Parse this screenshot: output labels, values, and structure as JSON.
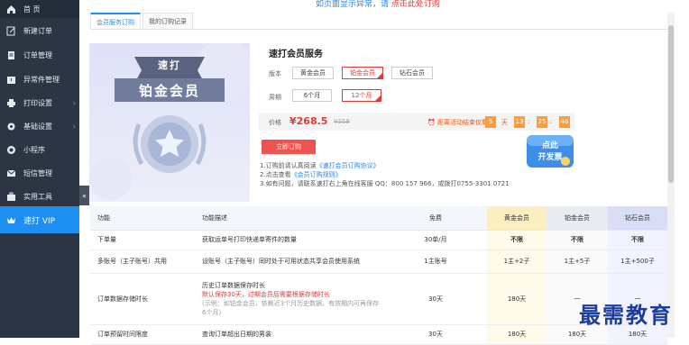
{
  "sidebar": {
    "items": [
      {
        "label": "首 页",
        "icon": "home-icon"
      },
      {
        "label": "新建订单",
        "icon": "edit-icon"
      },
      {
        "label": "订单管理",
        "icon": "document-icon"
      },
      {
        "label": "异常件管理",
        "icon": "warning-icon"
      },
      {
        "label": "打印设置",
        "icon": "printer-icon"
      },
      {
        "label": "基础设置",
        "icon": "gear-icon"
      },
      {
        "label": "小程序",
        "icon": "miniprogram-icon"
      },
      {
        "label": "短信管理",
        "icon": "sms-icon"
      },
      {
        "label": "实用工具",
        "icon": "toolbox-icon"
      },
      {
        "label": "速打 VIP",
        "icon": "vip-icon"
      }
    ],
    "collapse_glyph": "«"
  },
  "top_notice": {
    "text": "如页面显示异常，请 ",
    "link": "点击此处订购"
  },
  "tabs": [
    "会员服务订购",
    "我的订购记录"
  ],
  "product": {
    "image_ribbon": "速打",
    "image_banner": "铂金会员",
    "title": "速打会员服务",
    "version_label": "版本",
    "versions": [
      "黄金会员",
      "铂金会员",
      "钻石会员"
    ],
    "cycle_label": "周期",
    "cycles": [
      "6个月",
      "12个月"
    ],
    "price_label": "价格",
    "price": "¥268.5",
    "original_price": "¥358",
    "countdown_label": "距离活动结束仅剩",
    "countdown": {
      "days": "5",
      "day_unit": "天",
      "hours": "13",
      "minutes": "25",
      "seconds": "46"
    },
    "buy_button": "立即订购",
    "notes": [
      {
        "text": "1.订购前请认真阅读",
        "link": "《速打会员订购协议》"
      },
      {
        "text": "2.点击查看",
        "link": "《会员订购规则》"
      },
      {
        "text": "3.如有问题，请联系速打右上角在线客服 QQ：800 157 966，或拨打0755-3301 0721",
        "link": ""
      }
    ],
    "promo": {
      "line1": "点此",
      "line2": "开发票"
    }
  },
  "table": {
    "headers": [
      "功能",
      "功能描述",
      "免费",
      "黄金会员",
      "铂金会员",
      "钻石会员"
    ],
    "rows": [
      {
        "feature": "下单量",
        "desc": "获取运单号打印快递单寄件的数量",
        "desc_red": "",
        "desc_note": "",
        "free": "30单/月",
        "gold": "不限",
        "platinum": "不限",
        "diamond": "不限",
        "green": true
      },
      {
        "feature": "多账号（主子账号）共用",
        "desc": "设账号（主子账号）同时处于可用状态共享会员使用系统",
        "desc_red": "",
        "desc_note": "",
        "free": "1主账号",
        "gold": "1主+2子",
        "platinum": "1主+5子",
        "diamond": "1主+500子",
        "green": false
      },
      {
        "feature": "订单数据存储时长",
        "desc": "历史订单数据保存时长",
        "desc_red": "默认保存30天，过期会员后需要根据存储时长",
        "desc_note": "(示例：如铂金会员，依赖近3个月历史数据，有效期内可再保存6个月）",
        "free": "30天",
        "gold": "180天",
        "platinum": "一",
        "diamond": "一",
        "green": false
      },
      {
        "feature": "订单预留时间限度",
        "desc": "查询订单超出日期的男装",
        "desc_red": "",
        "desc_note": "",
        "free": "30天",
        "gold": "180天",
        "platinum": "180天",
        "diamond": "180天",
        "green": false
      }
    ]
  },
  "watermark": "最需教育",
  "colors": {
    "sidebar_bg": "#2b3544",
    "active_blue": "#1d8ff0",
    "price_red": "#e53935",
    "countdown_orange": "#ff9a3d"
  }
}
